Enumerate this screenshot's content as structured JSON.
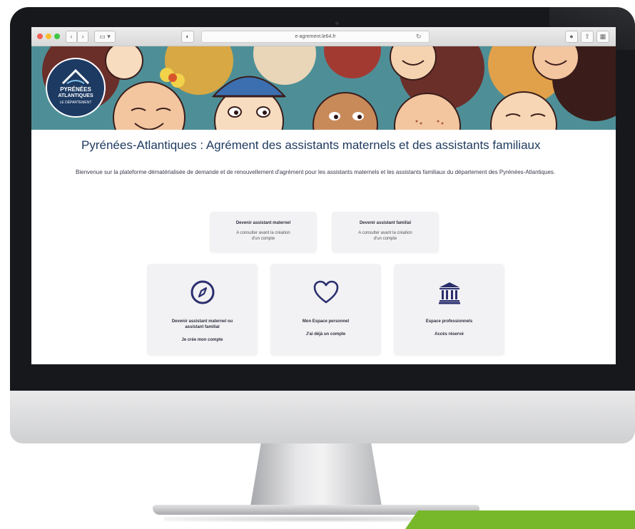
{
  "browser": {
    "url": "e-agrement.le64.fr"
  },
  "logo": {
    "line1": "PYRÉNÉES",
    "line2": "ATLANTIQUES",
    "line3": "LE DÉPARTEMENT"
  },
  "page": {
    "title": "Pyrénées-Atlantiques : Agrément des assistants maternels et des assistants familiaux",
    "intro": "Bienvenue sur la plateforme dématérialisée de demande et de renouvellement d'agrément pour les assistants maternels et les assistants familiaux du département des Pyrénées-Atlantiques."
  },
  "info_cards": [
    {
      "title": "Devenir assistant maternel",
      "sub1": "A consulter avant la création",
      "sub2": "d'un compte"
    },
    {
      "title": "Devenir assistant familial",
      "sub1": "A consulter avant la création",
      "sub2": "d'un compte"
    }
  ],
  "action_cards": [
    {
      "icon": "compass-icon",
      "line1": "Devenir assistant maternel ou",
      "line2": "assistant familial",
      "action": "Je crée mon compte"
    },
    {
      "icon": "heart-icon",
      "line1": "Mon Espace personnel",
      "line2": "",
      "action": "J'ai déjà un compte"
    },
    {
      "icon": "institution-icon",
      "line1": "Espace professionnels",
      "line2": "",
      "action": "Accès réservé"
    }
  ],
  "colors": {
    "accent": "#2b2f6e",
    "title": "#1e3a5f",
    "banner": "#4e8f97",
    "green": "#77b82a"
  }
}
